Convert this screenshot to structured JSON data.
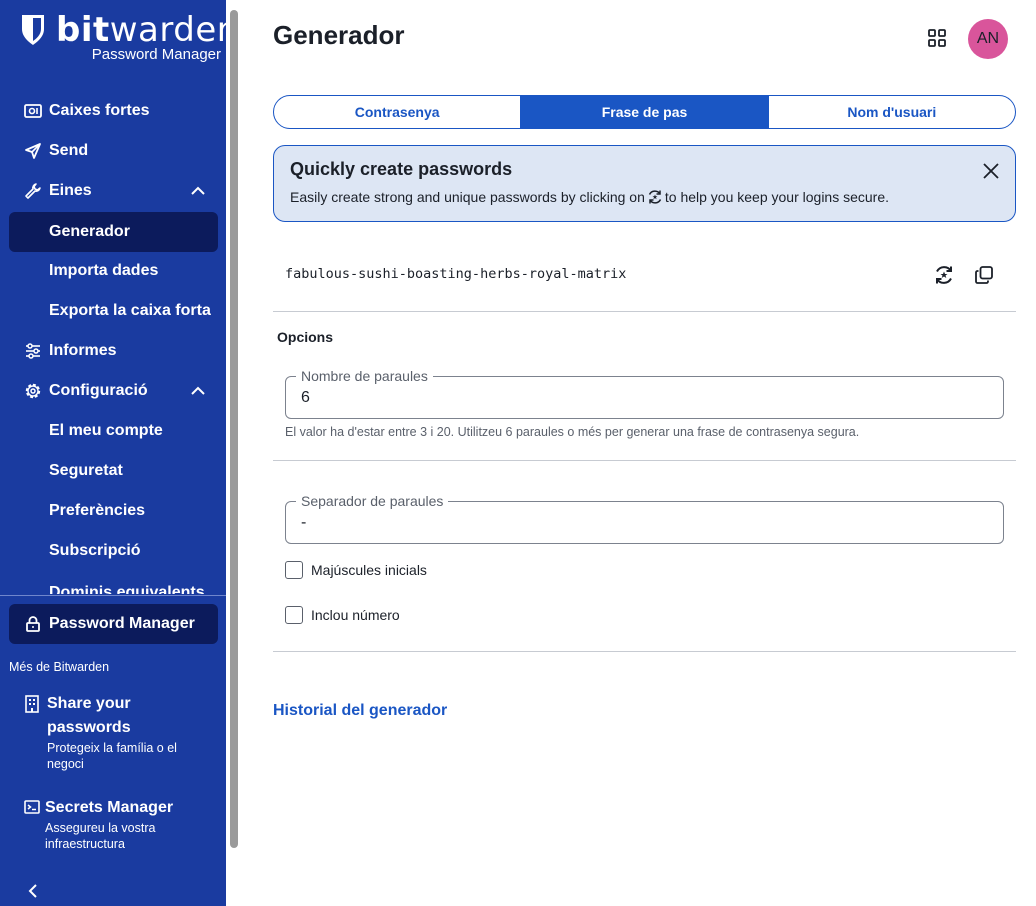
{
  "brand": {
    "name_bold": "bit",
    "name_light": "warden",
    "subtitle": "Password Manager"
  },
  "sidebar": {
    "items": [
      {
        "label": "Caixes fortes",
        "icon": "vault-icon"
      },
      {
        "label": "Send",
        "icon": "send-icon"
      },
      {
        "label": "Eines",
        "icon": "wrench-icon",
        "expanded": true
      },
      {
        "label": "Informes",
        "icon": "sliders-icon"
      },
      {
        "label": "Configuració",
        "icon": "gear-icon",
        "expanded": true
      }
    ],
    "tools_sub": [
      "Generador",
      "Importa dades",
      "Exporta la caixa forta"
    ],
    "settings_sub": [
      "El meu compte",
      "Seguretat",
      "Preferències",
      "Subscripció"
    ],
    "cut_item": "Dominis equivalents",
    "active": "Generador",
    "product_switcher": "Password Manager",
    "more_title": "Més de Bitwarden",
    "products": [
      {
        "name": "Share your passwords",
        "desc": "Protegeix la família o el negoci"
      },
      {
        "name": "Secrets Manager",
        "desc": "Assegureu la vostra infraestructura"
      }
    ]
  },
  "header": {
    "title": "Generador",
    "avatar_initials": "AN",
    "avatar_color": "#d9559b"
  },
  "tabs": [
    {
      "label": "Contrasenya",
      "active": false
    },
    {
      "label": "Frase de pas",
      "active": true
    },
    {
      "label": "Nom d'usuari",
      "active": false
    }
  ],
  "callout": {
    "title": "Quickly create passwords",
    "body_before": "Easily create strong and unique passwords by clicking on",
    "body_after": "to help you keep your logins secure."
  },
  "generated_value": "fabulous-sushi-boasting-herbs-royal-matrix",
  "options": {
    "title": "Opcions",
    "num_words_label": "Nombre de paraules",
    "num_words_value": "6",
    "num_words_hint": "El valor ha d'estar entre 3 i 20. Utilitzeu 6 paraules o més per generar una frase de contrasenya segura.",
    "separator_label": "Separador de paraules",
    "separator_value": "-",
    "capitalize_label": "Majúscules inicials",
    "capitalize_checked": false,
    "include_number_label": "Inclou número",
    "include_number_checked": false
  },
  "history_link": "Historial del generador",
  "colors": {
    "sidebar_bg": "#1a3ba0",
    "sidebar_active": "#0c1b5c",
    "primary": "#1a56c4",
    "callout_bg": "#dde6f4"
  }
}
